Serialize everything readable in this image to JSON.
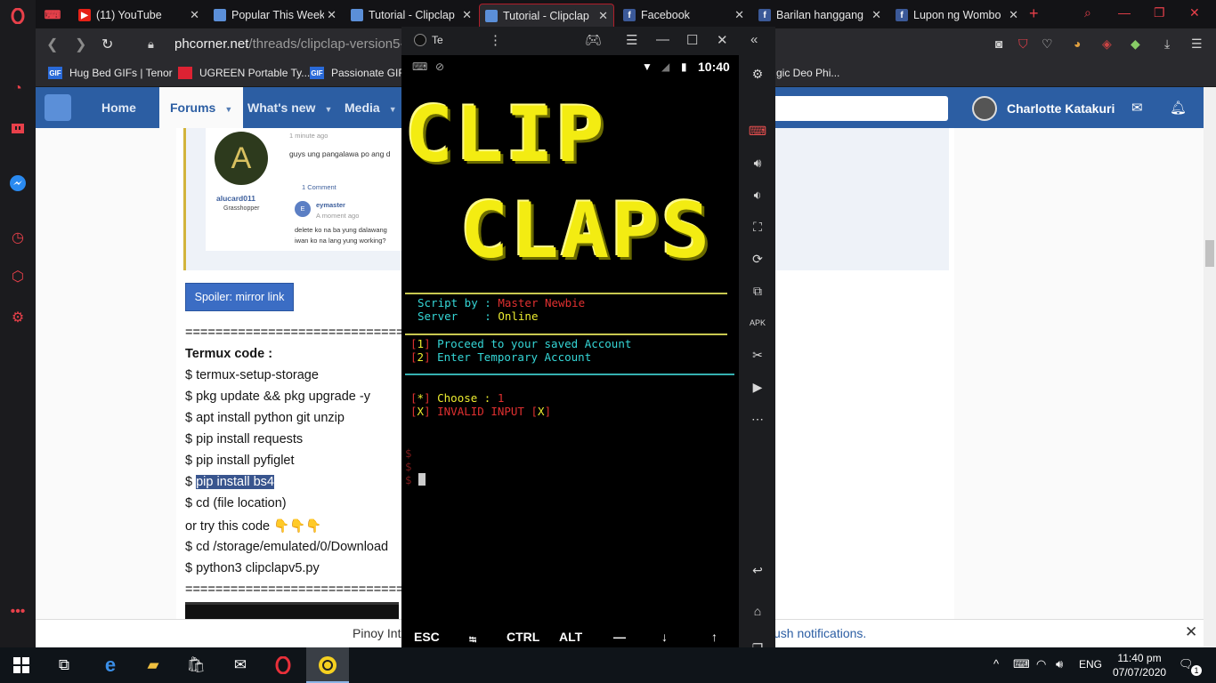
{
  "tabs": [
    {
      "title": "",
      "favicon": "game-icon",
      "color": "#e8404a"
    },
    {
      "title": "(11) YouTube",
      "favicon": "youtube-icon",
      "color": "#e62117"
    },
    {
      "title": "Popular This Week",
      "favicon": "phcorner-icon",
      "color": "#5b8fd8"
    },
    {
      "title": "Tutorial - Clipclap",
      "favicon": "phcorner-icon",
      "color": "#5b8fd8"
    },
    {
      "title": "Tutorial - Clipclap",
      "favicon": "phcorner-icon",
      "color": "#5b8fd8",
      "active": true
    },
    {
      "title": "Facebook",
      "favicon": "facebook-icon",
      "color": "#3b5998"
    },
    {
      "title": "Barilan hanggang",
      "favicon": "facebook-icon",
      "color": "#3b5998"
    },
    {
      "title": "Lupon ng Wombo",
      "favicon": "facebook-icon",
      "color": "#3b5998"
    }
  ],
  "address": {
    "host": "phcorner.net",
    "path": "/threads/clipclap-version5-0-"
  },
  "bookmarks": [
    {
      "label": "Hug Bed GIFs | Tenor",
      "fav": "GIF"
    },
    {
      "label": "UGREEN Portable Ty...",
      "fav": ""
    },
    {
      "label": "Passionate GIF",
      "fav": "GIF"
    },
    {
      "label": "gic Deo Phi...",
      "fav": ""
    }
  ],
  "forum_nav": {
    "home": "Home",
    "forums": "Forums",
    "whats_new": "What's new",
    "media": "Media",
    "username": "Charlotte Katakuri"
  },
  "quote": {
    "avatar_letter": "A",
    "user": "alucard011",
    "rank": "Grasshopper",
    "time": "1 minute ago",
    "text1": "guys ung pangalawa po ang d",
    "comment_count": "1 Comment",
    "reply_avatar": "E",
    "reply_user": "eymaster",
    "reply_time": "A moment ago",
    "reply_text1": "delete ko na ba yung dalawang",
    "reply_text2": "iwan ko na lang yung working?"
  },
  "post": {
    "spoiler_label": "Spoiler: mirror link",
    "divider": "=================================",
    "heading": "Termux code :",
    "lines": [
      "$ termux-setup-storage",
      "$ pkg update && pkg upgrade -y",
      "$ apt install python git unzip",
      "$ pip install requests",
      "$ pip install pyfiglet"
    ],
    "line_highlight_prefix": "$ ",
    "line_highlight": "pip install bs4",
    "line_cd": "$ cd (file location)",
    "line_or": "or try this code 👇👇👇",
    "line_cd2": "$ cd /storage/emulated/0/Download",
    "line_run": "$ python3 clipclapv5.py"
  },
  "notice": {
    "left": "Pinoy Int",
    "right": "ush notifications."
  },
  "emulator": {
    "tab_title": "Te",
    "time": "10:40",
    "banner_line1": "CLIP",
    "banner_line2": "CLAPS",
    "script_by_label": "Script by : ",
    "script_by_value": "Master Newbie",
    "server_label": "Server    : ",
    "server_value": "Online",
    "menu1_num": "1",
    "menu1_text": "Proceed to your saved Account",
    "menu2_num": "2",
    "menu2_text": "Enter Temporary Account",
    "choose_marker": "*",
    "choose_label": "Choose : ",
    "choose_value": "1",
    "err_marker": "X",
    "err_text": "INVALID INPUT",
    "prompt": "$",
    "keys": [
      "ESC",
      "⭾",
      "CTRL",
      "ALT",
      "—",
      "↓",
      "↑"
    ]
  },
  "taskbar": {
    "lang": "ENG",
    "time": "11:40 pm",
    "date": "07/07/2020",
    "notif_count": "1"
  },
  "colors": {
    "accent": "#e8404a",
    "forum_blue": "#2c5ea3",
    "term_yellow": "#ecec30",
    "term_cyan": "#35d6d6"
  }
}
